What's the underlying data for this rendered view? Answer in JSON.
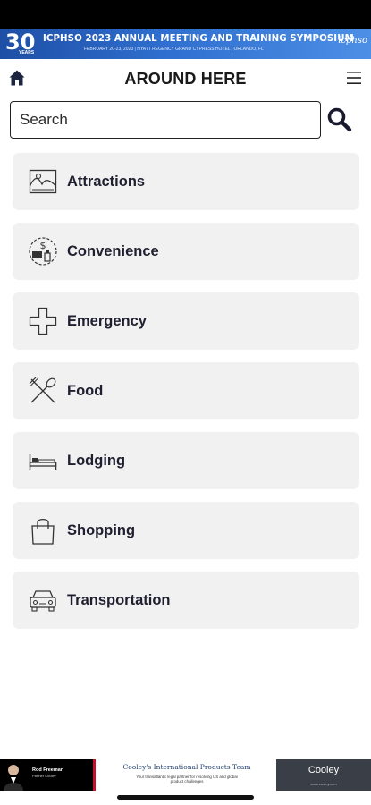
{
  "banner": {
    "badge_number": "30",
    "badge_caption": "YEARS",
    "title": "ICPHSO 2023 ANNUAL MEETING AND TRAINING SYMPOSIUM",
    "subtitle": "FEBRUARY 20-23, 2023 | HYATT REGENCY GRAND CYPRESS HOTEL | ORLANDO, FL",
    "brand": "icphso",
    "colors": {
      "start": "#1e4fa6",
      "end": "#4d8fe6"
    }
  },
  "header": {
    "title": "AROUND HERE",
    "home_icon": "home-icon",
    "menu_icon": "hamburger-menu-icon"
  },
  "search": {
    "placeholder": "Search",
    "value": "",
    "icon": "search-icon"
  },
  "categories": [
    {
      "label": "Attractions",
      "icon": "landscape-picture-icon"
    },
    {
      "label": "Convenience",
      "icon": "convenience-money-icon"
    },
    {
      "label": "Emergency",
      "icon": "medical-cross-icon"
    },
    {
      "label": "Food",
      "icon": "fork-spoon-icon"
    },
    {
      "label": "Lodging",
      "icon": "bed-icon"
    },
    {
      "label": "Shopping",
      "icon": "shopping-bag-icon"
    },
    {
      "label": "Transportation",
      "icon": "car-icon"
    }
  ],
  "ad": {
    "left_name": "Rod Freeman",
    "left_role": "Partner Cooley",
    "headline": "Cooley's International Products Team",
    "subline": "Your transatlantic legal partner for resolving US and global product challenges",
    "brand": "Cooley",
    "url": "www.cooley.com",
    "accent": "#c8102e"
  }
}
